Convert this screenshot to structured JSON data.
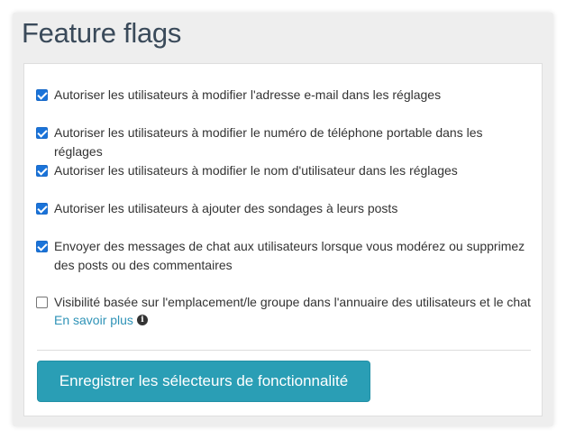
{
  "panel": {
    "title": "Feature flags"
  },
  "options": [
    {
      "label": "Autoriser les utilisateurs à modifier l'adresse e-mail dans les réglages",
      "checked": true
    },
    {
      "label": "Autoriser les utilisateurs à modifier le numéro de téléphone portable dans les réglages",
      "checked": true
    },
    {
      "label": "Autoriser les utilisateurs à modifier le nom d'utilisateur dans les réglages",
      "checked": true
    },
    {
      "label": "Autoriser les utilisateurs à ajouter des sondages à leurs posts",
      "checked": true
    },
    {
      "label": "Envoyer des messages de chat aux utilisateurs lorsque vous modérez ou supprimez des posts ou des commentaires",
      "checked": true
    },
    {
      "label": "Visibilité basée sur l'emplacement/le groupe dans l'annuaire des utilisateurs et le chat",
      "checked": false,
      "learn_more": "En savoir plus",
      "info_icon": "info-circle-icon"
    }
  ],
  "save_button": {
    "label": "Enregistrer les sélecteurs de fonctionnalité"
  },
  "colors": {
    "accent": "#2a9eb5",
    "checkbox": "#1a73d9",
    "link": "#2f93b7",
    "title": "#3a4a5a"
  }
}
